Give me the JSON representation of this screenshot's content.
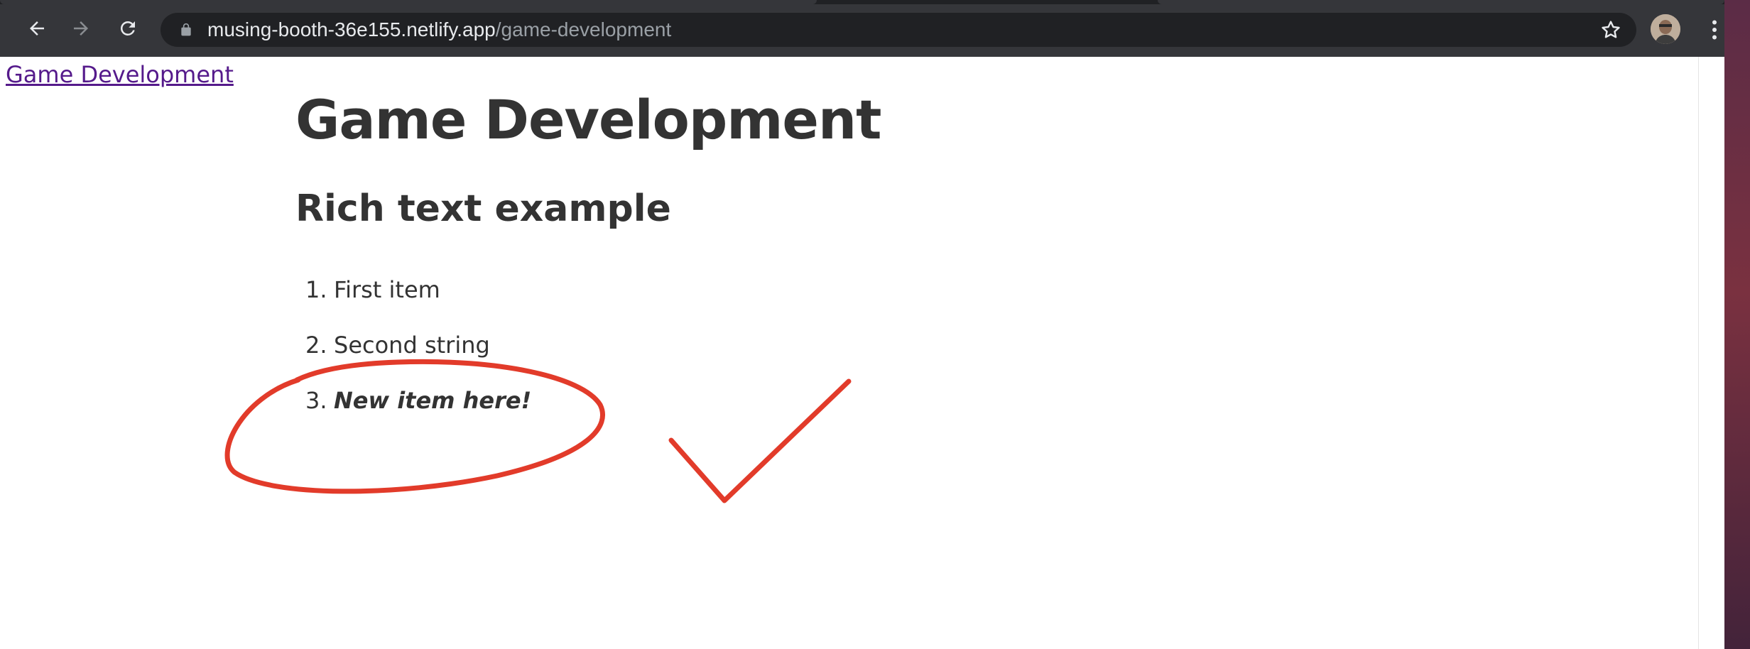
{
  "browser": {
    "url_host": "musing-booth-36e155.netlify.app",
    "url_path": "/game-development",
    "back_icon": "back-arrow-icon",
    "forward_icon": "forward-arrow-icon",
    "reload_icon": "reload-icon",
    "lock_icon": "lock-icon",
    "star_icon": "star-icon",
    "menu_icon": "kebab-menu-icon",
    "toolbar_color": "#35363a",
    "omnibox_color": "#202124"
  },
  "page": {
    "top_link": "Game Development",
    "title": "Game Development",
    "subtitle": "Rich text example",
    "list": [
      {
        "number": "1.",
        "text": "First item"
      },
      {
        "number": "2.",
        "text": "Second string"
      },
      {
        "number": "3.",
        "text": "New item here!"
      }
    ],
    "text_color": "#333333",
    "link_color": "#551a8b"
  },
  "annotations": {
    "color": "#e23b2a",
    "shapes": [
      "circle-around-item-3",
      "checkmark"
    ]
  }
}
